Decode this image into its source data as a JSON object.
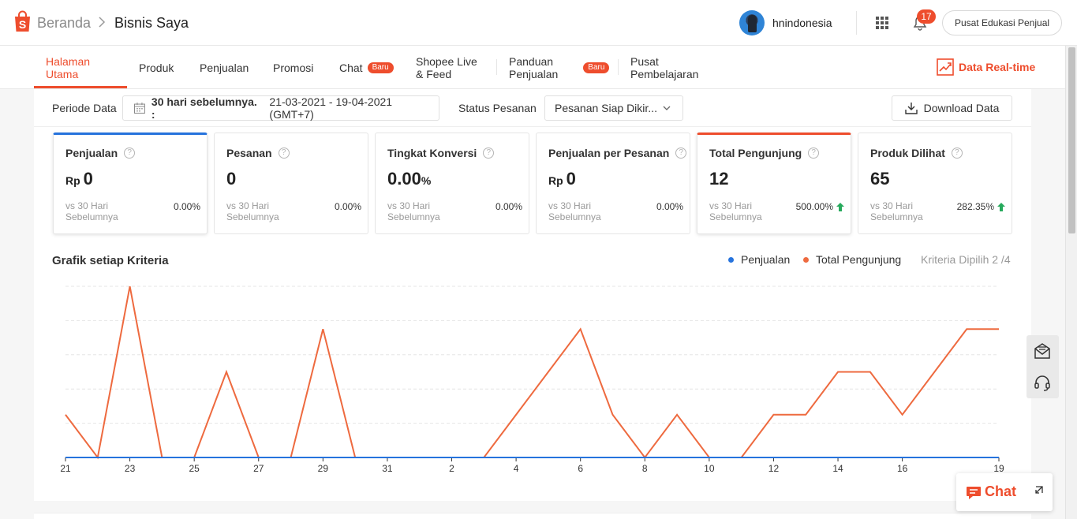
{
  "header": {
    "breadcrumb_home": "Beranda",
    "page_title": "Bisnis Saya",
    "username": "hnindonesia",
    "notification_count": "17",
    "edu_button": "Pusat Edukasi Penjual"
  },
  "nav": {
    "items": [
      {
        "label_line1": "Halaman",
        "label_line2": "Utama",
        "active": true
      },
      {
        "label_line1": "Produk",
        "label_line2": ""
      },
      {
        "label_line1": "Penjualan",
        "label_line2": ""
      },
      {
        "label_line1": "Promosi",
        "label_line2": ""
      },
      {
        "label_line1": "Chat",
        "label_line2": "",
        "badge": "Baru"
      },
      {
        "label_line1": "Shopee Live",
        "label_line2": "& Feed"
      },
      {
        "label_line1": "Panduan",
        "label_line2": "Penjualan",
        "badge": "Baru"
      },
      {
        "label_line1": "Pusat",
        "label_line2": "Pembelajaran"
      }
    ],
    "realtime_label": "Data Real-time"
  },
  "filters": {
    "period_label": "Periode Data",
    "period_bold": "30 hari sebelumnya. :",
    "period_range": "21-03-2021 - 19-04-2021 (GMT+7)",
    "status_label": "Status Pesanan",
    "status_value": "Pesanan Siap Dikir...",
    "download_label": "Download Data"
  },
  "metrics": [
    {
      "title": "Penjualan",
      "unit": "Rp",
      "value": "0",
      "suffix": "",
      "compare": "vs 30 Hari Sebelumnya",
      "change": "0.00%",
      "trend": "none",
      "selected": "blue"
    },
    {
      "title": "Pesanan",
      "unit": "",
      "value": "0",
      "suffix": "",
      "compare": "vs 30 Hari Sebelumnya",
      "change": "0.00%",
      "trend": "none",
      "selected": ""
    },
    {
      "title": "Tingkat Konversi",
      "unit": "",
      "value": "0.00",
      "suffix": "%",
      "compare": "vs 30 Hari Sebelumnya",
      "change": "0.00%",
      "trend": "none",
      "selected": ""
    },
    {
      "title": "Penjualan per Pesanan",
      "unit": "Rp",
      "value": "0",
      "suffix": "",
      "compare": "vs 30 Hari Sebelumnya",
      "change": "0.00%",
      "trend": "none",
      "selected": ""
    },
    {
      "title": "Total Pengunjung",
      "unit": "",
      "value": "12",
      "suffix": "",
      "compare": "vs 30 Hari Sebelumnya",
      "change": "500.00%",
      "trend": "up",
      "selected": "orange"
    },
    {
      "title": "Produk Dilihat",
      "unit": "",
      "value": "65",
      "suffix": "",
      "compare": "vs 30 Hari Sebelumnya",
      "change": "282.35%",
      "trend": "up",
      "selected": ""
    }
  ],
  "chart_section": {
    "title": "Grafik setiap Kriteria",
    "legend_sales": "Penjualan",
    "legend_visitors": "Total Pengunjung",
    "criteria": "Kriteria Dipilih 2 /4"
  },
  "chat_widget": {
    "label": "Chat"
  },
  "chart_data": {
    "type": "line",
    "x": [
      "21",
      "22",
      "23",
      "24",
      "25",
      "26",
      "27",
      "28",
      "29",
      "30",
      "31",
      "1",
      "2",
      "3",
      "4",
      "5",
      "6",
      "7",
      "8",
      "9",
      "10",
      "11",
      "12",
      "13",
      "14",
      "15",
      "16",
      "17",
      "18",
      "19"
    ],
    "tick_labels": [
      "21",
      "23",
      "25",
      "27",
      "29",
      "31",
      "2",
      "4",
      "6",
      "8",
      "10",
      "12",
      "14",
      "16",
      "19"
    ],
    "ylim": [
      0,
      4
    ],
    "grid": true,
    "series": [
      {
        "name": "Penjualan",
        "color": "#2673dd",
        "values": [
          0,
          0,
          0,
          0,
          0,
          0,
          0,
          0,
          0,
          0,
          0,
          0,
          0,
          0,
          0,
          0,
          0,
          0,
          0,
          0,
          0,
          0,
          0,
          0,
          0,
          0,
          0,
          0,
          0,
          0
        ]
      },
      {
        "name": "Total Pengunjung",
        "color": "#ee6a3f",
        "values": [
          1,
          0,
          4,
          0,
          0,
          2,
          0,
          0,
          3,
          0,
          0,
          0,
          0,
          0,
          1,
          2,
          3,
          1,
          0,
          1,
          0,
          0,
          1,
          1,
          2,
          2,
          1,
          2,
          3,
          3
        ]
      }
    ]
  },
  "colors": {
    "brand": "#ee4d2d",
    "sales_line": "#2673dd",
    "visitors_line": "#ee6a3f",
    "trend_up": "#26aa5c"
  }
}
